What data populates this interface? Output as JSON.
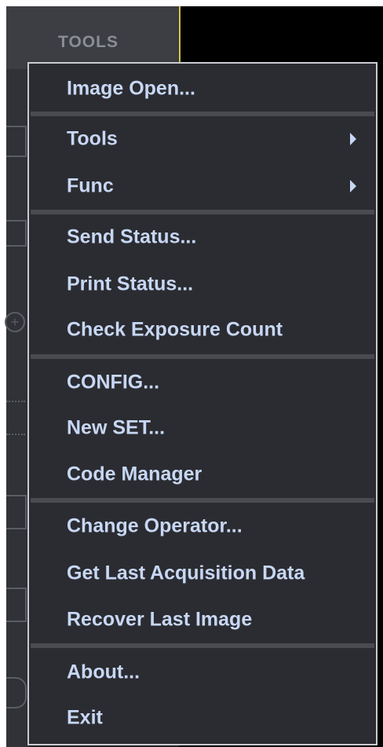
{
  "background": {
    "tab_label": "TOOLS"
  },
  "menu": {
    "items": [
      {
        "label": "Image Open...",
        "submenu": false
      },
      {
        "label": "Tools",
        "submenu": true
      },
      {
        "label": "Func",
        "submenu": true
      },
      {
        "label": "Send Status...",
        "submenu": false
      },
      {
        "label": "Print Status...",
        "submenu": false
      },
      {
        "label": "Check Exposure Count",
        "submenu": false
      },
      {
        "label": "CONFIG...",
        "submenu": false
      },
      {
        "label": "New SET...",
        "submenu": false
      },
      {
        "label": "Code Manager",
        "submenu": false
      },
      {
        "label": "Change Operator...",
        "submenu": false
      },
      {
        "label": "Get Last Acquisition Data",
        "submenu": false
      },
      {
        "label": "Recover Last Image",
        "submenu": false
      },
      {
        "label": "About...",
        "submenu": false
      },
      {
        "label": "Exit",
        "submenu": false
      }
    ]
  },
  "colors": {
    "menu_background": "#2b2c31",
    "menu_text": "#c7d7f4",
    "menu_border": "#c9cbd0",
    "separator": "#4a4b50"
  }
}
